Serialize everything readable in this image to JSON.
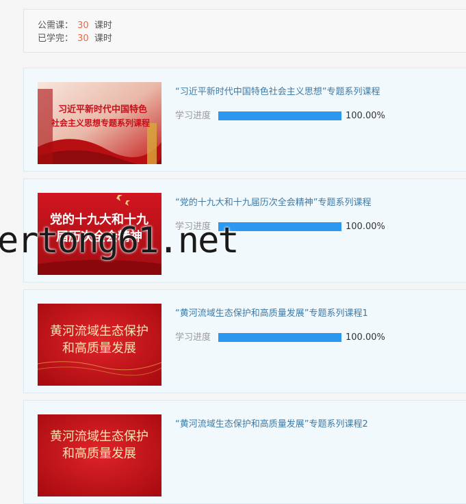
{
  "summary": {
    "required_label": "公需课：",
    "required_value": "30",
    "required_unit": "课时",
    "completed_label": "已学完：",
    "completed_value": "30",
    "completed_unit": "课时"
  },
  "progress_label": "学习进度",
  "courses": [
    {
      "title": "“习近平新时代中国特色社会主义思想”专题系列课程",
      "thumb_line1": "习近平新时代中国特色",
      "thumb_line2": "社会主义思想专题系列课程",
      "progress_fraction": 1.0,
      "progress_text": "100.00%"
    },
    {
      "title": "“党的十九大和十九届历次全会精神”专题系列课程",
      "thumb_line1": "党的十九大和十九",
      "thumb_line2": "届历次全会精神",
      "progress_fraction": 1.0,
      "progress_text": "100.00%"
    },
    {
      "title": "“黄河流域生态保护和高质量发展”专题系列课程1",
      "thumb_line1": "黄河流域生态保护",
      "thumb_line2": "和高质量发展",
      "progress_fraction": 1.0,
      "progress_text": "100.00%"
    },
    {
      "title": "“黄河流域生态保护和高质量发展”专题系列课程2",
      "thumb_line1": "黄河流域生态保护",
      "thumb_line2": "和高质量发展"
    }
  ],
  "watermark": "ertong61.net",
  "colors": {
    "accent_number": "#f0643c",
    "progress_fill": "#2b97ef",
    "title_link": "#3c7aa6",
    "thumb_red": "#c8101b"
  }
}
